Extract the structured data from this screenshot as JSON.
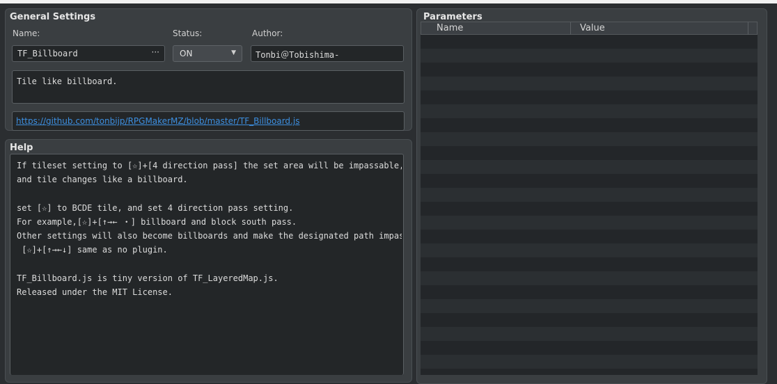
{
  "general": {
    "title": "General Settings",
    "name_label": "Name:",
    "status_label": "Status:",
    "author_label": "Author:",
    "name_value": "TF_Billboard",
    "name_more": "···",
    "status_value": "ON",
    "author_value": "Tonbi＠Tobishima-",
    "description": "Tile like billboard.",
    "url": "https://github.com/tonbijp/RPGMakerMZ/blob/master/TF_Billboard.js"
  },
  "help": {
    "title": "Help",
    "lines": [
      "If tileset setting to [☆]+[4 direction pass] the set area will be impassable,",
      "and tile changes like a billboard.",
      "",
      "set [☆] to BCDE tile, and set 4 direction pass setting.",
      "For example,[☆]+[↑→← ・] billboard and block south pass.",
      "Other settings will also become billboards and make the designated path impassa",
      " [☆]+[↑→←↓] same as no plugin.",
      "",
      "TF_Billboard.js is tiny version of TF_LayeredMap.js.",
      "Released under the MIT License."
    ]
  },
  "parameters": {
    "title": "Parameters",
    "columns": [
      "Name",
      "Value"
    ],
    "rows": []
  },
  "colors": {
    "background": "#2b2e31",
    "panel": "#3a3e41",
    "field": "#232628",
    "link": "#3d8fe0"
  }
}
